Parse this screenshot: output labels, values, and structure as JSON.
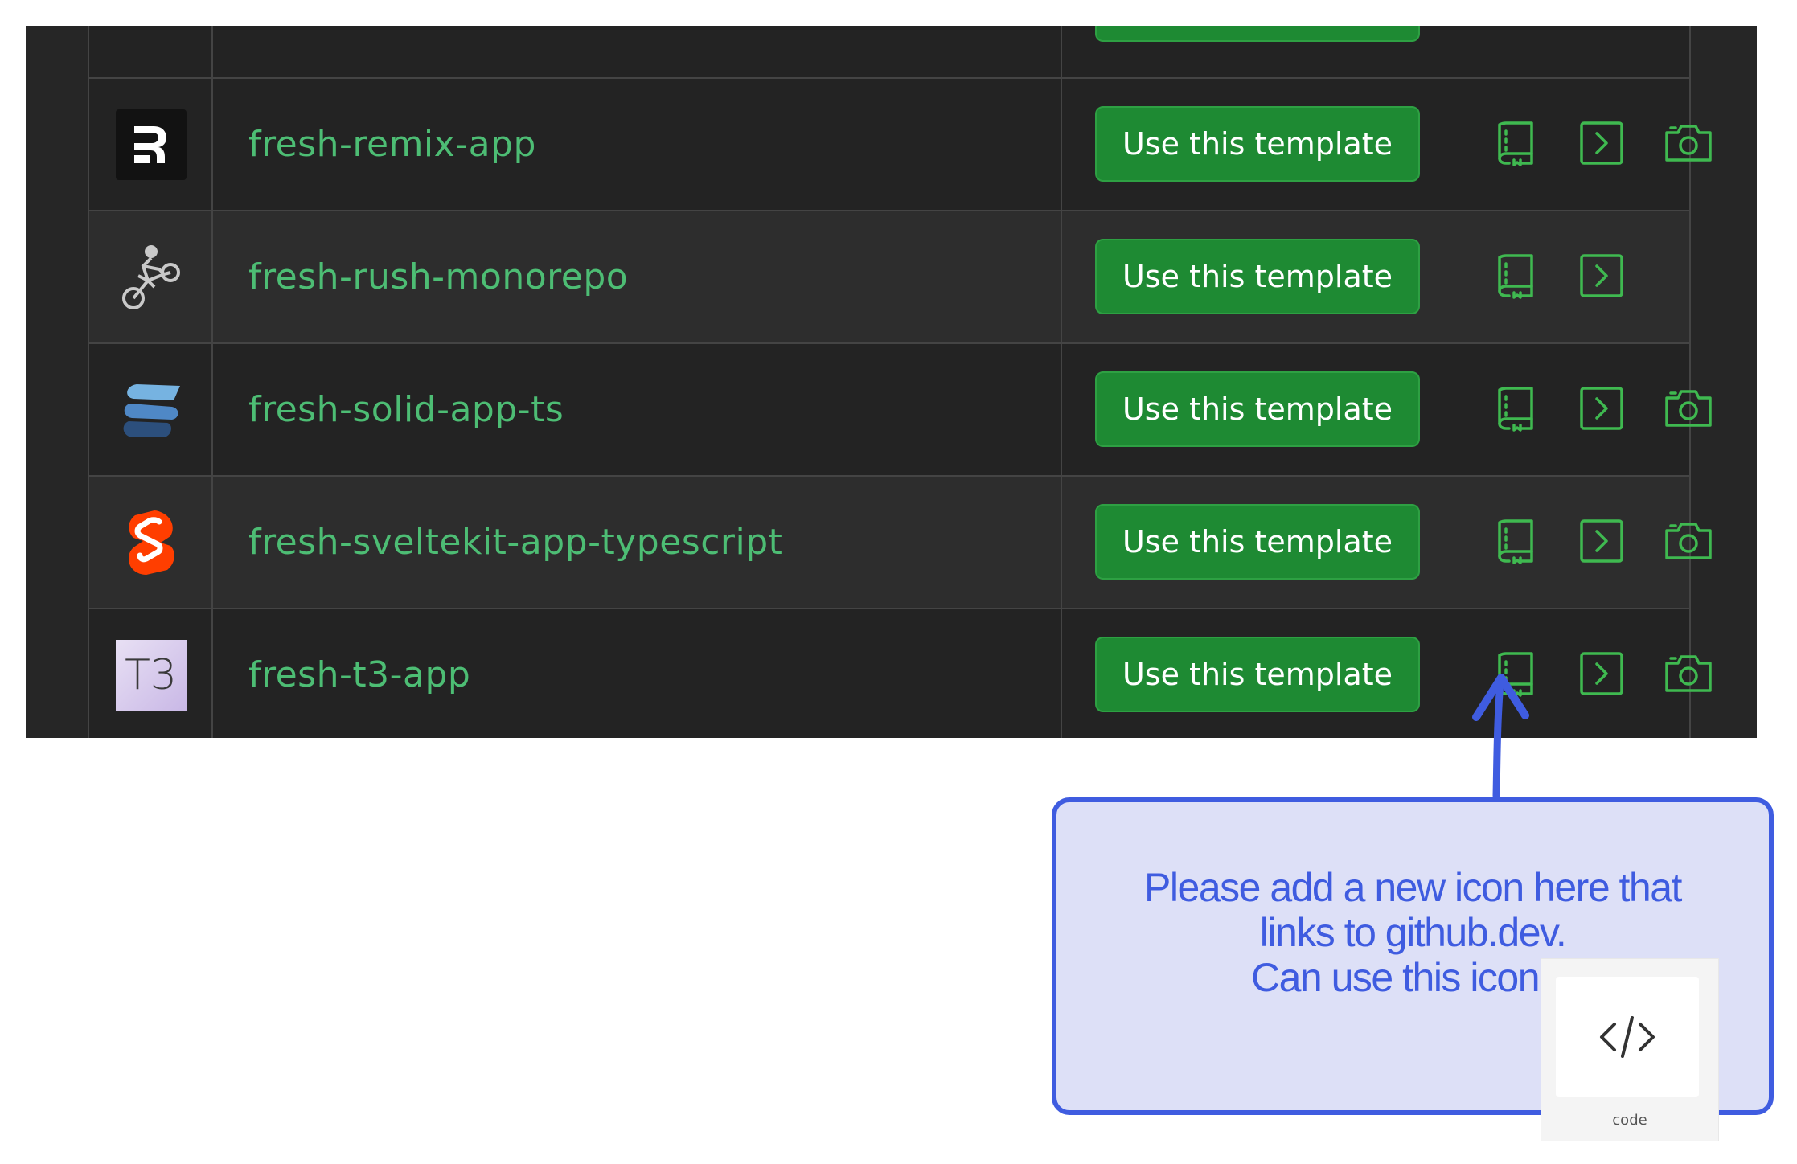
{
  "rows": [
    {
      "name": "fresh-remix-app",
      "logo": "remix-logo-icon",
      "button": "Use this template",
      "actions": [
        "readme-book-icon",
        "terminal-chevron-icon",
        "camera-icon"
      ]
    },
    {
      "name": "fresh-rush-monorepo",
      "logo": "rush-motorbike-logo-icon",
      "button": "Use this template",
      "actions": [
        "readme-book-icon",
        "terminal-chevron-icon"
      ]
    },
    {
      "name": "fresh-solid-app-ts",
      "logo": "solid-logo-icon",
      "button": "Use this template",
      "actions": [
        "readme-book-icon",
        "terminal-chevron-icon",
        "camera-icon"
      ]
    },
    {
      "name": "fresh-sveltekit-app-typescript",
      "logo": "svelte-logo-icon",
      "button": "Use this template",
      "actions": [
        "readme-book-icon",
        "terminal-chevron-icon",
        "camera-icon"
      ]
    },
    {
      "name": "fresh-t3-app",
      "logo": "t3-logo-icon",
      "button": "Use this template",
      "actions": [
        "readme-book-icon",
        "terminal-chevron-icon",
        "camera-icon"
      ]
    }
  ],
  "t3_logo_text": "T3",
  "annotation": {
    "line1": "Please add a new icon here that",
    "line2": "links to github.dev.",
    "line3": "Can use this icon",
    "icon_caption": "code",
    "icon": "code-brackets-icon"
  },
  "colors": {
    "panel_bg": "#262626",
    "link_green": "#4dbd74",
    "button_green": "#1e8a33",
    "annotation_blue": "#3f5ce0",
    "annotation_fill": "#dde0f7"
  }
}
